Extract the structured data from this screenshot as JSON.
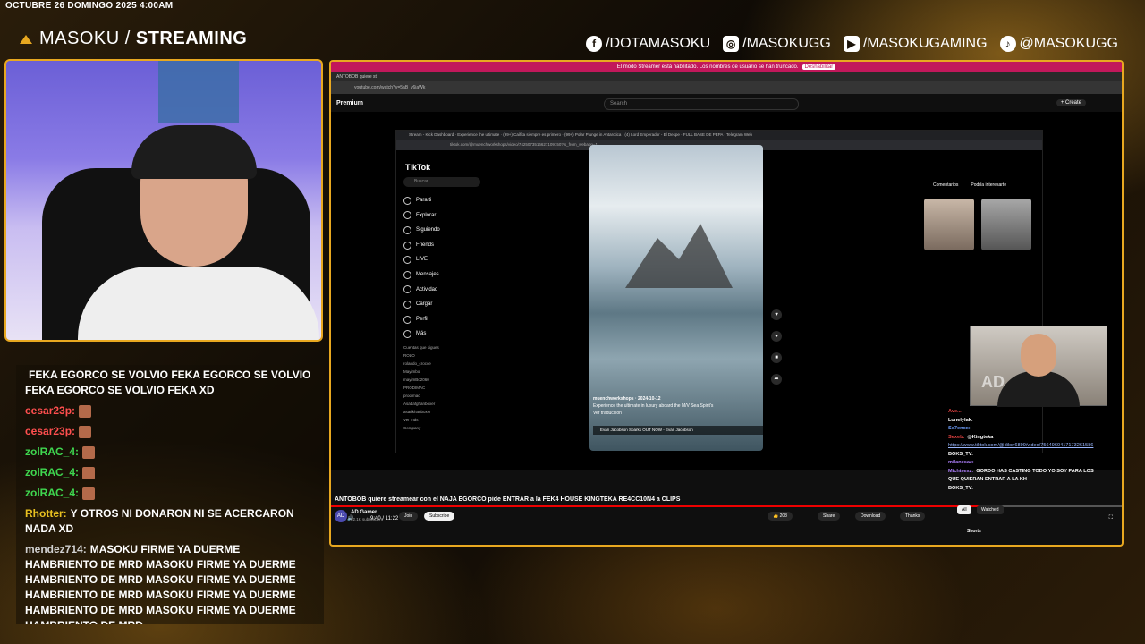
{
  "overlay": {
    "datetime": "OCTUBRE 26 DOMINGO 2025 4:00AM",
    "brand_light": "MASOKU /",
    "brand_bold": "STREAMING",
    "socials": [
      {
        "icon": "facebook-icon",
        "glyph": "f",
        "handle": "/DOTAMASOKU"
      },
      {
        "icon": "instagram-icon",
        "glyph": "◎",
        "handle": "/MASOKUGG"
      },
      {
        "icon": "youtube-icon",
        "glyph": "▶",
        "handle": "/MASOKUGAMING"
      },
      {
        "icon": "tiktok-icon",
        "glyph": "♪",
        "handle": "@MASOKUGG"
      }
    ],
    "accent": "#e8a820"
  },
  "chat": {
    "messages": [
      {
        "user": "",
        "color": "#ffffff",
        "text": "FEKA EGORCO SE VOLVIO FEKA EGORCO SE VOLVIO FEKA EGORCO SE VOLVIO FEKA XD"
      },
      {
        "user": "cesar23p:",
        "color": "#ff4f4f",
        "text": ""
      },
      {
        "user": "cesar23p:",
        "color": "#ff4f4f",
        "text": ""
      },
      {
        "user": "zolRAC_4:",
        "color": "#3fd64f",
        "text": ""
      },
      {
        "user": "zolRAC_4:",
        "color": "#3fd64f",
        "text": ""
      },
      {
        "user": "zolRAC_4:",
        "color": "#3fd64f",
        "text": ""
      },
      {
        "user": "Rhotter:",
        "color": "#e8c020",
        "text": "Y OTROS NI DONARON NI SE ACERCARON NADA XD"
      },
      {
        "user": "mendez714:",
        "color": "#d0d0d0",
        "text": "MASOKU FIRME YA DUERME HAMBRIENTO DE MRD MASOKU FIRME YA DUERME HAMBRIENTO DE MRD MASOKU FIRME YA DUERME HAMBRIENTO DE MRD MASOKU FIRME YA DUERME HAMBRIENTO DE MRD MASOKU FIRME YA DUERME HAMBRIENTO DE MRD"
      }
    ]
  },
  "browser": {
    "notice": "El modo Streamer está habilitado. Los nombres de usuario se han truncado.",
    "notice_button": "Deshabilitar",
    "tab": "ANTOBOB quiere st",
    "url": "youtube.com/watch?v=5aB_v6jaWk",
    "premium": "Premium",
    "search_placeholder": "Search",
    "create": "+ Create",
    "time": "9:40 / 11:22",
    "title": "ANTOBOB quiere streamear con el ÑAJA EGORCO pide ENTRAR a la FEK4 HOUSE KINGTEKA RE4CC10N4 a CLIPS",
    "channel": "AD Gamer",
    "subs": "92.1K subscribers",
    "join": "Join",
    "subscribe": "Subscribe",
    "likes": "208",
    "share": "Share",
    "download": "Download",
    "thanks": "Thanks",
    "filter_all": "All",
    "filter_watched": "Watched",
    "shorts": "Shorts"
  },
  "inner": {
    "tabs": "Stream - Kick Dashboard   ·   Experience the ultimate   ·   (99+) Caífita siempre es primero   ·   (99+) Polar Plunge in Antarctica   ·   (4) Lord Emperador - El Despe   ·   FULL BASE DE PEPA   ·   Telegram Web",
    "url": "tiktok.com/@muenchworkshops/video/7425073516627109150?is_from_webapp=1",
    "logo": "TikTok",
    "search": "Buscar",
    "nav": [
      "Para ti",
      "Explorar",
      "Siguiendo",
      "Friends",
      "LIVE",
      "Mensajes",
      "Actividad",
      "Cargar",
      "Perfil",
      "Más"
    ],
    "follow_title": "Cuentas que sigues",
    "follow": [
      "ROLO",
      "rolando_crocce",
      "Mayimbo",
      "mayimBo2060",
      "PRODIMAC",
      "prodimac",
      "Asadafghanboxer",
      "asadkhanboxer",
      "Ver más"
    ],
    "footer": "Company",
    "clip_user": "muenchworkshops · 2024-10-12",
    "clip_caption": "Experience the ultimate in luxury aboard the M/V Sea Spirit's",
    "clip_translate": "Ver traducción",
    "clip_more": "más",
    "clip_song": "Evan Jacobson Sparks OUT NOW - Evan Jacobson",
    "right_tab1": "Comentarios",
    "right_tab2": "Podría interesarte"
  },
  "inner_chat": [
    {
      "user": "Ave...",
      "color": "#e04040",
      "text": ""
    },
    {
      "user": "Lonelylak:",
      "color": "#ffffff",
      "text": ""
    },
    {
      "user": "Se7enxx:",
      "color": "#6fa0ff",
      "text": ""
    },
    {
      "user": "Sexeb:",
      "color": "#e04040",
      "text": "@Kingteka"
    },
    {
      "user": "",
      "color": "#9ab7ff",
      "text": "https://www.tiktok.com/@dilon6899/video/7564960417173261586"
    },
    {
      "user": "BOKS_TV:",
      "color": "#ffffff",
      "text": ""
    },
    {
      "user": "milanesaz:",
      "color": "#b080ff",
      "text": ""
    },
    {
      "user": "Michisexz:",
      "color": "#b080ff",
      "text": "GORDO HAS CASTING TODO YO SOY PARA LOS QUE QUIERAN ENTRAR A LA KH"
    },
    {
      "user": "BOKS_TV:",
      "color": "#ffffff",
      "text": ""
    }
  ]
}
